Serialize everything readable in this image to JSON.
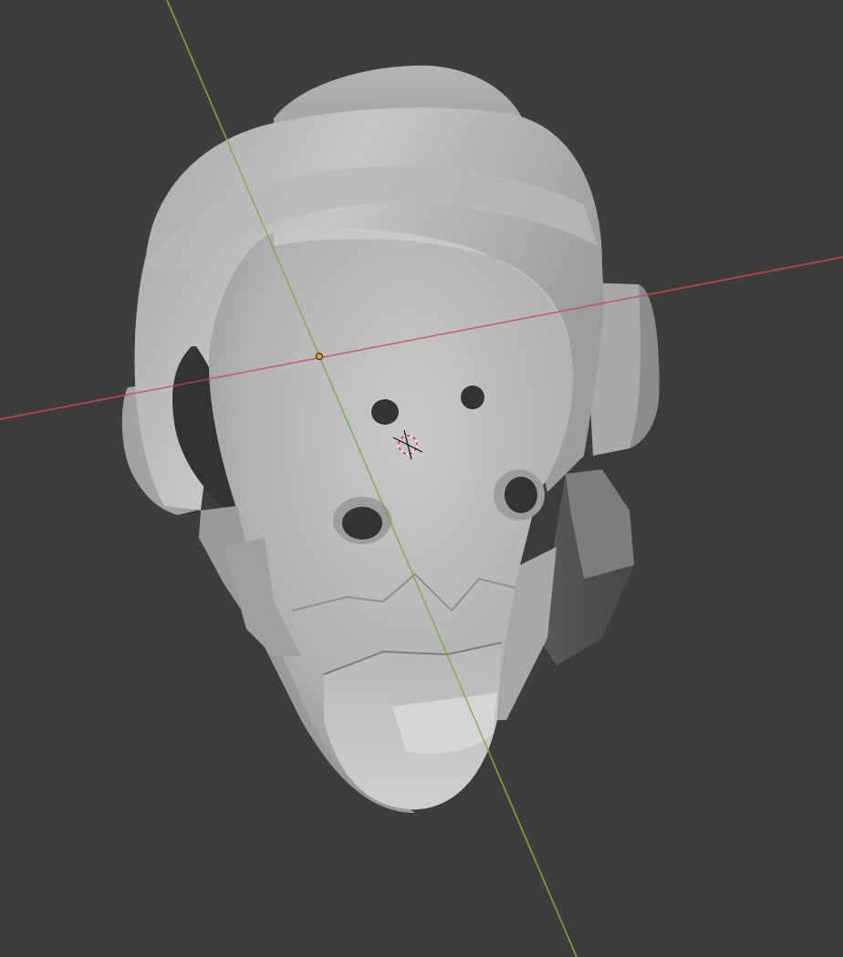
{
  "viewport": {
    "background": "#3d3d3d",
    "mode": "3d-viewport-solid-shading"
  },
  "scene": {
    "object": "head-mesh",
    "axes": {
      "x_axis_color": "#c0484f",
      "y_axis_color": "#7aa23c"
    },
    "origin_dot_color": "#e3a32a",
    "cursor": "3d-cursor-icon"
  }
}
